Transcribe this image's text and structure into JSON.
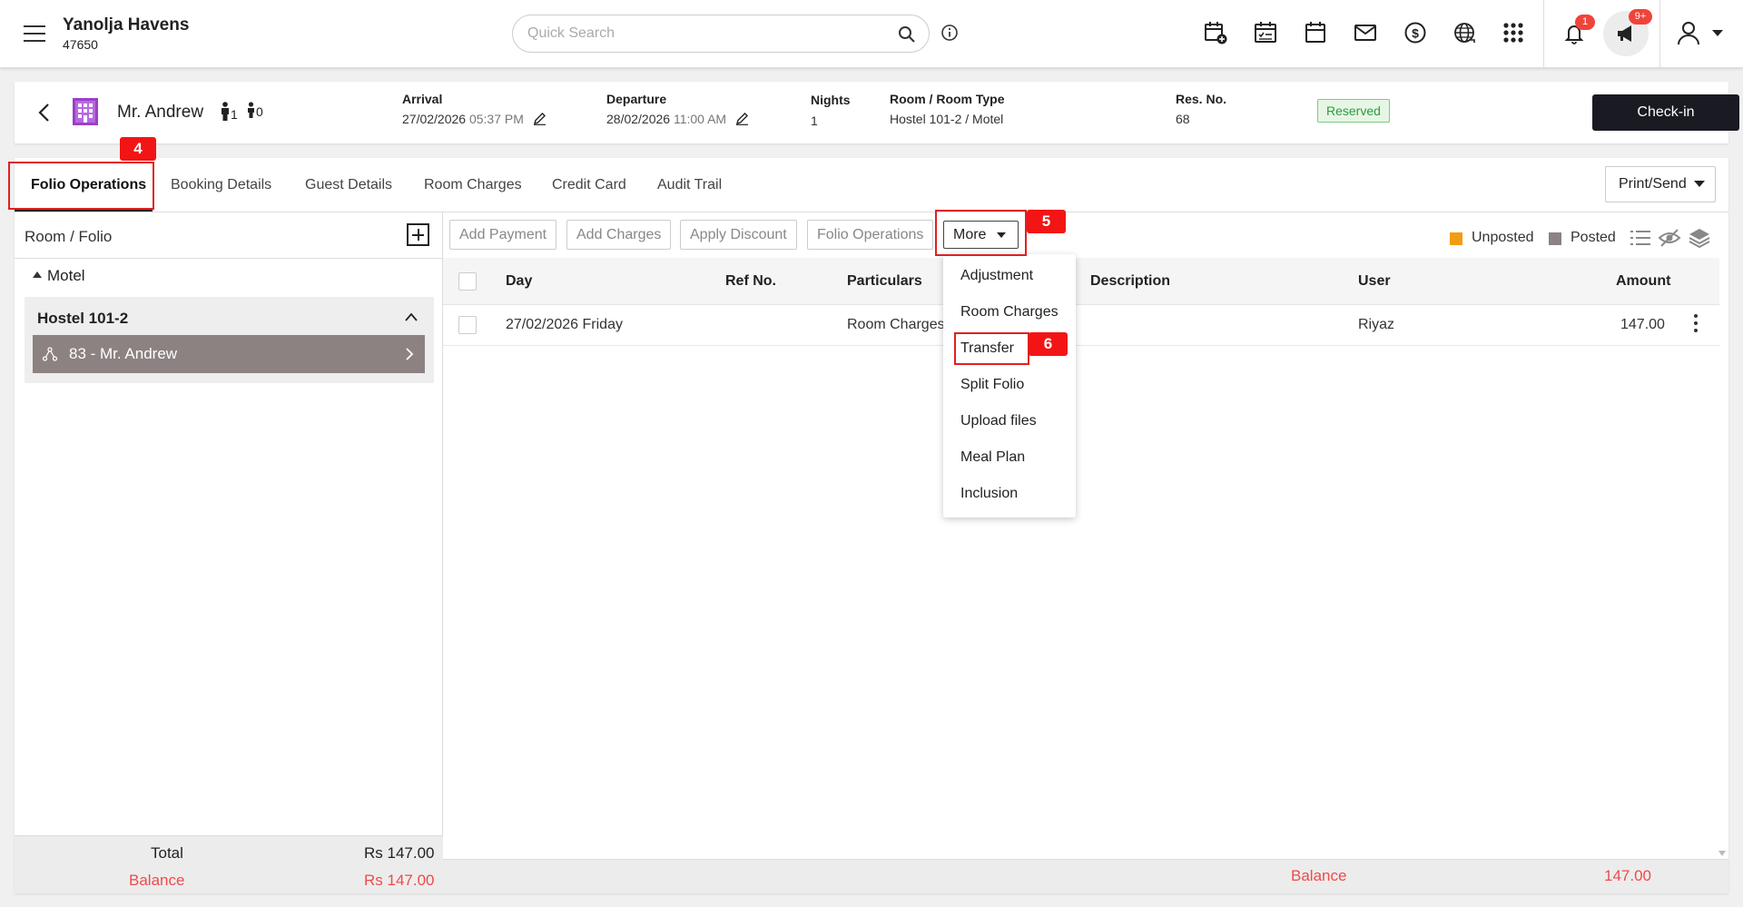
{
  "header": {
    "hotel_name": "Yanolja Havens",
    "hotel_id": "47650",
    "search_placeholder": "Quick Search",
    "notification_count": "1",
    "announcement_count": "9+"
  },
  "reservation": {
    "guest_name": "Mr. Andrew",
    "adults": "1",
    "children": "0",
    "arrival_label": "Arrival",
    "arrival_date": "27/02/2026",
    "arrival_time": "05:37 PM",
    "departure_label": "Departure",
    "departure_date": "28/02/2026",
    "departure_time": "11:00 AM",
    "nights_label": "Nights",
    "nights": "1",
    "room_label": "Room / Room Type",
    "room": "Hostel 101-2 / Motel",
    "resno_label": "Res. No.",
    "resno": "68",
    "status": "Reserved",
    "checkin_label": "Check-in"
  },
  "tabs": [
    {
      "label": "Folio Operations"
    },
    {
      "label": "Booking Details"
    },
    {
      "label": "Guest Details"
    },
    {
      "label": "Room Charges"
    },
    {
      "label": "Credit Card"
    },
    {
      "label": "Audit Trail"
    }
  ],
  "print_send_label": "Print/Send",
  "annotations": [
    "4",
    "5",
    "6"
  ],
  "left_panel": {
    "title": "Room / Folio",
    "group": "Motel",
    "room": "Hostel 101-2",
    "folio": "83 - Mr. Andrew",
    "total_label": "Total",
    "total_value": "Rs 147.00",
    "balance_label": "Balance",
    "balance_value": "Rs 147.00"
  },
  "actions": {
    "add_payment": "Add Payment",
    "add_charges": "Add Charges",
    "apply_discount": "Apply Discount",
    "folio_operations": "Folio Operations",
    "more": "More"
  },
  "legend": {
    "unposted": "Unposted",
    "posted": "Posted",
    "unposted_color": "#f39c12",
    "posted_color": "#8c8282"
  },
  "table": {
    "columns": [
      "Day",
      "Ref No.",
      "Particulars",
      "Description",
      "User",
      "Amount"
    ],
    "rows": [
      {
        "day": "27/02/2026 Friday",
        "ref": "",
        "particulars": "Room Charges",
        "description": "",
        "user": "Riyaz",
        "amount": "147.00"
      }
    ],
    "balance_label": "Balance",
    "balance_value": "147.00"
  },
  "more_menu": {
    "items": [
      "Adjustment",
      "Room Charges",
      "Transfer",
      "Split Folio",
      "Upload files",
      "Meal Plan",
      "Inclusion"
    ]
  }
}
